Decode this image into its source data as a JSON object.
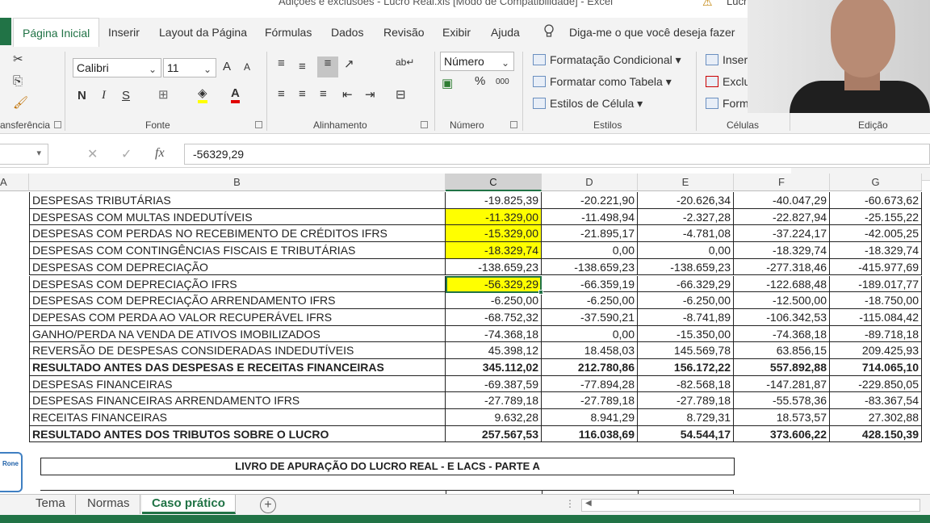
{
  "window": {
    "title": "Adições e exclusões - Lucro Real.xls  [Modo de Compatibilidade]  -  Excel",
    "user": "Lucr"
  },
  "ribbon_tabs": [
    {
      "label": "Página Inicial",
      "active": true
    },
    {
      "label": "Inserir"
    },
    {
      "label": "Layout da Página"
    },
    {
      "label": "Fórmulas"
    },
    {
      "label": "Dados"
    },
    {
      "label": "Revisão"
    },
    {
      "label": "Exibir"
    },
    {
      "label": "Ajuda"
    }
  ],
  "tell_me": "Diga-me o que você deseja fazer",
  "groups": {
    "clipboard": "ansferência",
    "font": "Fonte",
    "alignment": "Alinhamento",
    "number": "Número",
    "styles": "Estilos",
    "cells": "Células",
    "editing": "Edição"
  },
  "font": {
    "name": "Calibri",
    "size": "11",
    "bold": "N",
    "italic": "I",
    "underline": "S",
    "grow": "A",
    "shrink": "A",
    "color": "A"
  },
  "number_format": "Número",
  "number_btns": {
    "percent": "%",
    "thousands": "000"
  },
  "styles": {
    "conditional": "Formatação Condicional",
    "table": "Formatar como Tabela",
    "cell": "Estilos de Célula"
  },
  "cells": {
    "insert": "Inser",
    "delete": "Exclu",
    "format": "Form"
  },
  "formula_bar": {
    "fx": "fx",
    "value": "-56329,29"
  },
  "col_a": "A",
  "columns": [
    "B",
    "C",
    "D",
    "E",
    "F",
    "G"
  ],
  "rows": [
    {
      "label": "DESPESAS TRIBUTÁRIAS",
      "values": [
        "-19.825,39",
        "-20.221,90",
        "-20.626,34",
        "-40.047,29",
        "-60.673,62"
      ],
      "bold": false,
      "hl": false
    },
    {
      "label": "DESPESAS COM MULTAS INDEDUTÍVEIS",
      "values": [
        "-11.329,00",
        "-11.498,94",
        "-2.327,28",
        "-22.827,94",
        "-25.155,22"
      ],
      "bold": false,
      "hl": true
    },
    {
      "label": "DESPESAS COM PERDAS NO RECEBIMENTO DE CRÉDITOS IFRS",
      "values": [
        "-15.329,00",
        "-21.895,17",
        "-4.781,08",
        "-37.224,17",
        "-42.005,25"
      ],
      "bold": false,
      "hl": true
    },
    {
      "label": "DESPESAS COM CONTINGÊNCIAS FISCAIS E TRIBUTÁRIAS",
      "values": [
        "-18.329,74",
        "0,00",
        "0,00",
        "-18.329,74",
        "-18.329,74"
      ],
      "bold": false,
      "hl": true
    },
    {
      "label": "DESPESAS COM DEPRECIAÇÃO",
      "values": [
        "-138.659,23",
        "-138.659,23",
        "-138.659,23",
        "-277.318,46",
        "-415.977,69"
      ],
      "bold": false,
      "hl": false
    },
    {
      "label": "DESPESAS COM DEPRECIAÇÃO IFRS",
      "values": [
        "-56.329,29",
        "-66.359,19",
        "-66.329,29",
        "-122.688,48",
        "-189.017,77"
      ],
      "bold": false,
      "hl": true
    },
    {
      "label": "DESPESAS COM DEPRECIAÇÃO ARRENDAMENTO IFRS",
      "values": [
        "-6.250,00",
        "-6.250,00",
        "-6.250,00",
        "-12.500,00",
        "-18.750,00"
      ],
      "bold": false,
      "hl": false
    },
    {
      "label": "DEPESAS COM PERDA AO VALOR RECUPERÁVEL IFRS",
      "values": [
        "-68.752,32",
        "-37.590,21",
        "-8.741,89",
        "-106.342,53",
        "-115.084,42"
      ],
      "bold": false,
      "hl": false
    },
    {
      "label": "GANHO/PERDA NA VENDA DE ATIVOS IMOBILIZADOS",
      "values": [
        "-74.368,18",
        "0,00",
        "-15.350,00",
        "-74.368,18",
        "-89.718,18"
      ],
      "bold": false,
      "hl": false
    },
    {
      "label": "REVERSÃO DE DESPESAS CONSIDERADAS INDEDUTÍVEIS",
      "values": [
        "45.398,12",
        "18.458,03",
        "145.569,78",
        "63.856,15",
        "209.425,93"
      ],
      "bold": false,
      "hl": false
    },
    {
      "label": "RESULTADO ANTES DAS DESPESAS E RECEITAS FINANCEIRAS",
      "values": [
        "345.112,02",
        "212.780,86",
        "156.172,22",
        "557.892,88",
        "714.065,10"
      ],
      "bold": true,
      "hl": false
    },
    {
      "label": "DESPESAS FINANCEIRAS",
      "values": [
        "-69.387,59",
        "-77.894,28",
        "-82.568,18",
        "-147.281,87",
        "-229.850,05"
      ],
      "bold": false,
      "hl": false
    },
    {
      "label": "DESPESAS FINANCEIRAS ARRENDAMENTO IFRS",
      "values": [
        "-27.789,18",
        "-27.789,18",
        "-27.789,18",
        "-55.578,36",
        "-83.367,54"
      ],
      "bold": false,
      "hl": false
    },
    {
      "label": "RECEITAS FINANCEIRAS",
      "values": [
        "9.632,28",
        "8.941,29",
        "8.729,31",
        "18.573,57",
        "27.302,88"
      ],
      "bold": false,
      "hl": false
    },
    {
      "label": "RESULTADO ANTES DOS TRIBUTOS SOBRE O LUCRO",
      "values": [
        "257.567,53",
        "116.038,69",
        "54.544,17",
        "373.606,22",
        "428.150,39"
      ],
      "bold": true,
      "hl": false
    }
  ],
  "livro_title": "LIVRO DE APURAÇÃO DO LUCRO REAL - E LACS - PARTE A",
  "logo_text": "Rone",
  "sheets": [
    {
      "label": "Tema"
    },
    {
      "label": "Normas"
    },
    {
      "label": "Caso prático",
      "active": true
    }
  ],
  "add_sheet": "+"
}
